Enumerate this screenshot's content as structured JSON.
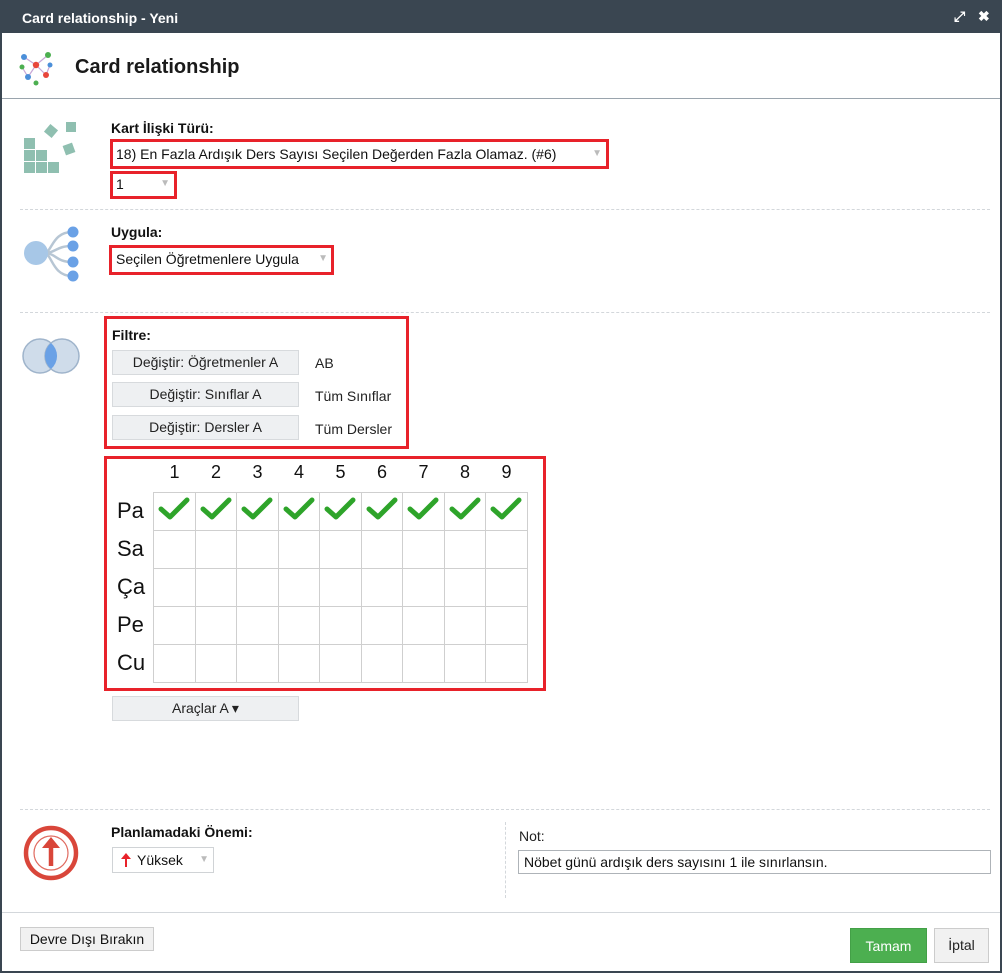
{
  "window": {
    "title": "Card relationship - Yeni",
    "maximize_glyph": "⤢",
    "close_glyph": "✖"
  },
  "header": {
    "title": "Card relationship"
  },
  "relationship": {
    "label": "Kart İlişki Türü:",
    "type_value": "18) En Fazla Ardışık Ders Sayısı Seçilen Değerden Fazla Olamaz. (#6)",
    "count_value": "1"
  },
  "apply": {
    "label": "Uygula:",
    "value": "Seçilen Öğretmenlere Uygula"
  },
  "filter": {
    "label": "Filtre:",
    "rows": [
      {
        "button": "Değiştir: Öğretmenler A",
        "value": "AB"
      },
      {
        "button": "Değiştir: Sınıflar A",
        "value": "Tüm Sınıflar"
      },
      {
        "button": "Değiştir: Dersler A",
        "value": "Tüm Dersler"
      }
    ]
  },
  "timetable": {
    "periods": [
      "1",
      "2",
      "3",
      "4",
      "5",
      "6",
      "7",
      "8",
      "9"
    ],
    "days": [
      "Pa",
      "Sa",
      "Ça",
      "Pe",
      "Cu"
    ],
    "checked_day_index": 0,
    "check_color": "#2ea42a"
  },
  "tools_button": "Araçlar A ▾",
  "importance": {
    "label": "Planlamadaki Önemi:",
    "value": "Yüksek",
    "icon": "red-up-arrow-icon"
  },
  "note": {
    "label": "Not:",
    "value": "Nöbet günü ardışık ders sayısını 1 ile sınırlansın."
  },
  "footer": {
    "disable_label": "Devre Dışı Bırakın",
    "ok_label": "Tamam",
    "cancel_label": "İptal"
  },
  "colors": {
    "titlebar": "#3a4651",
    "highlight": "#e8222a",
    "ok": "#4caf50"
  }
}
